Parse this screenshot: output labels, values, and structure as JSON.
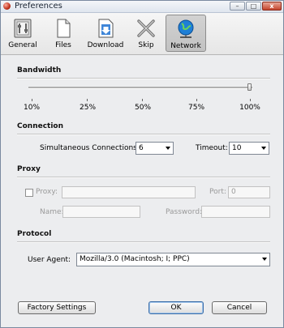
{
  "window": {
    "title": "Preferences",
    "min_label": "–",
    "max_label": "□",
    "close_label": "x"
  },
  "toolbar": {
    "items": [
      {
        "label": "General",
        "icon": "general-prefs-icon",
        "selected": false
      },
      {
        "label": "Files",
        "icon": "file-icon",
        "selected": false
      },
      {
        "label": "Download",
        "icon": "download-icon",
        "selected": false
      },
      {
        "label": "Skip",
        "icon": "skip-icon",
        "selected": false
      },
      {
        "label": "Network",
        "icon": "network-globe-icon",
        "selected": true
      }
    ]
  },
  "bandwidth": {
    "title": "Bandwidth",
    "ticks": [
      "10%",
      "25%",
      "50%",
      "75%",
      "100%"
    ],
    "value": "100%"
  },
  "connection": {
    "title": "Connection",
    "simultaneous_label": "Simultaneous Connections:",
    "simultaneous_value": "6",
    "timeout_label": "Timeout:",
    "timeout_value": "10"
  },
  "proxy": {
    "title": "Proxy",
    "proxy_label": "Proxy:",
    "proxy_enabled": false,
    "proxy_value": "",
    "port_label": "Port:",
    "port_value": "0",
    "name_label": "Name:",
    "name_value": "",
    "password_label": "Password:",
    "password_value": ""
  },
  "protocol": {
    "title": "Protocol",
    "user_agent_label": "User Agent:",
    "user_agent_value": "Mozilla/3.0 (Macintosh; I; PPC)"
  },
  "buttons": {
    "factory_settings": "Factory Settings",
    "ok": "OK",
    "cancel": "Cancel"
  },
  "colors": {
    "window_bg": "#ecedef",
    "selected_tab_bg": "#c8c8c8",
    "globe_blue": "#1f7fd6"
  }
}
